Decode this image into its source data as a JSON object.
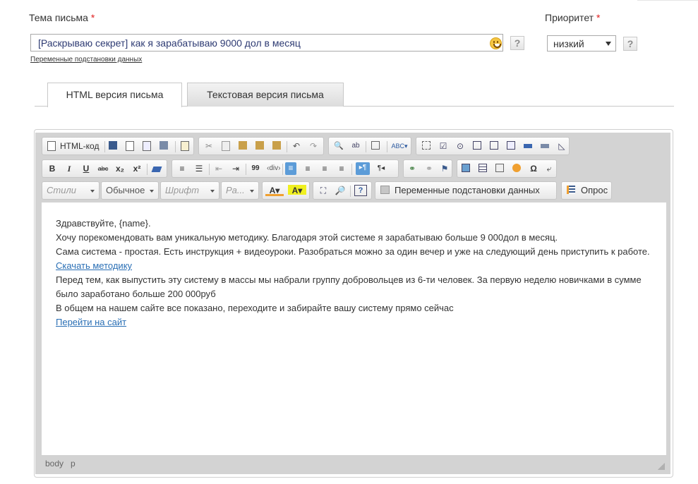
{
  "subject": {
    "label": "Тема письма",
    "required_mark": "*",
    "value": "[Раскрываю секрет] как я зарабатываю 9000 дол в месяц",
    "help": "?",
    "vars_link": "Переменные подстановки данных"
  },
  "priority": {
    "label": "Приоритет",
    "required_mark": "*",
    "selected": "низкий",
    "help": "?"
  },
  "tabs": [
    {
      "label": "HTML версия письма",
      "active": true
    },
    {
      "label": "Текстовая версия письма",
      "active": false
    }
  ],
  "toolbar": {
    "source_label": "HTML-код",
    "styles_placeholder": "Стили",
    "format_value": "Обычное",
    "font_placeholder": "Шрифт",
    "size_placeholder": "Ра...",
    "vars_button": "Переменные подстановки данных",
    "poll_button": "Опрос",
    "bold": "B",
    "italic": "I",
    "underline": "U",
    "strike": "abc",
    "subscript": "x₂",
    "superscript": "x²",
    "blockquote": "99",
    "help": "?"
  },
  "body": {
    "greeting": "Здравствуйте, {name}.",
    "line1": "Хочу порекомендовать вам уникальную методику. Благодаря этой системе я зарабатываю больше 9 000дол в месяц.",
    "line2": "Сама система - простая. Есть инструкция + видеоуроки. Разобраться можно за один вечер и уже на следующий день приступить к работе.",
    "link1": "Скачать методику",
    "line3": "Перед тем, как выпустить эту систему в массы мы набрали группу добровольцев из 6-ти человек. За первую неделю новичками в сумме было заработано больше 200 000руб",
    "line4": "В общем на нашем сайте все показано, переходите и забирайте вашу систему прямо сейчас",
    "link2": "Перейти на сайт"
  },
  "status": {
    "path_body": "body",
    "path_p": "p"
  },
  "colors": {
    "accent": "#5c9cd8",
    "link": "#2a6fb5",
    "required": "#e02020"
  }
}
